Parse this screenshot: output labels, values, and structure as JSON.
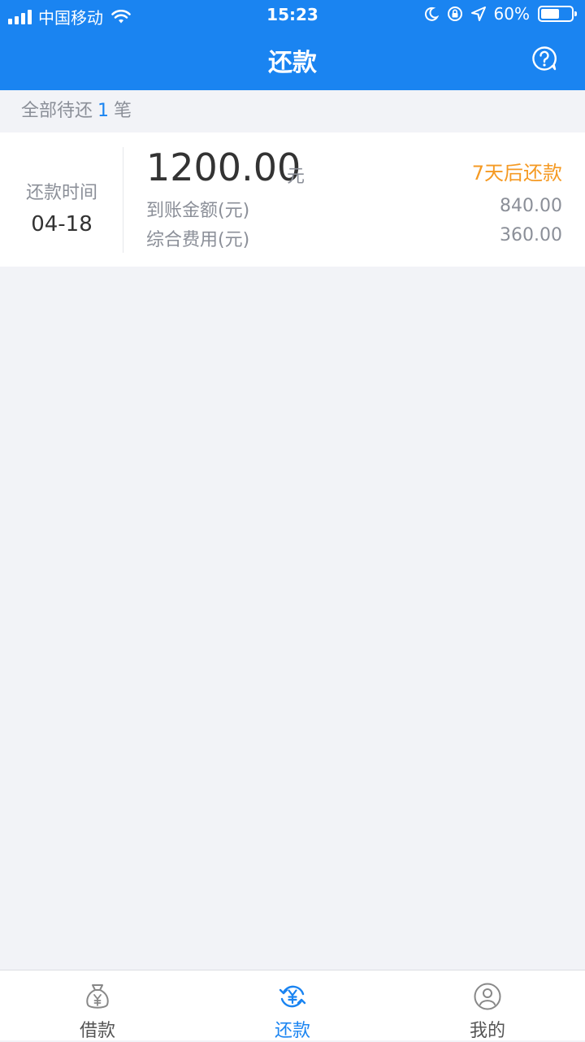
{
  "status_bar": {
    "carrier": "中国移动",
    "time": "15:23",
    "battery": "60%",
    "battery_level": 0.6
  },
  "header": {
    "title": "还款",
    "help_icon": "question-bubble-icon"
  },
  "summary": {
    "prefix": "全部待还",
    "count": "1",
    "suffix": "笔"
  },
  "repayment": {
    "time_label": "还款时间",
    "date": "04-18",
    "amount": "1200.00",
    "unit": "元",
    "days_left": "7天后还款",
    "received_label": "到账金额(元)",
    "received_value": "840.00",
    "fee_label": "综合费用(元)",
    "fee_value": "360.00"
  },
  "tabs": [
    {
      "label": "借款",
      "icon": "money-bag-icon",
      "active": false
    },
    {
      "label": "还款",
      "icon": "repay-cycle-icon",
      "active": true
    },
    {
      "label": "我的",
      "icon": "user-circle-icon",
      "active": false
    }
  ],
  "colors": {
    "brand": "#1a84f1",
    "accent_orange": "#f59a23",
    "background": "#f2f3f7"
  }
}
